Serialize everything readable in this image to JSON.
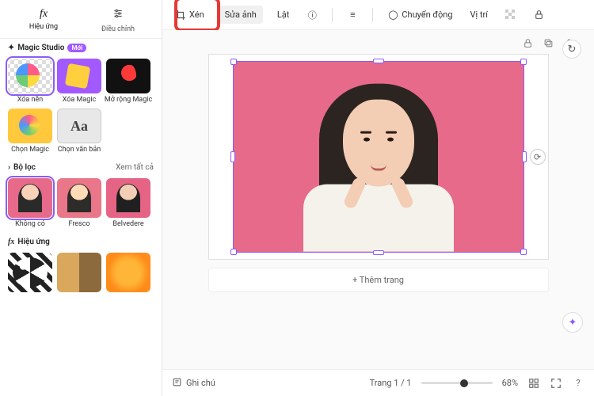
{
  "left_panel": {
    "tabs": [
      {
        "label": "Hiệu ứng",
        "icon": "fx"
      },
      {
        "label": "Điều chỉnh",
        "icon": "adjust"
      }
    ],
    "magic_studio": {
      "title": "Magic Studio",
      "badge": "Mới",
      "tools": [
        {
          "label": "Xóa nền"
        },
        {
          "label": "Xóa Magic"
        },
        {
          "label": "Mở rộng Magic"
        },
        {
          "label": "Chọn Magic"
        },
        {
          "label": "Chọn văn bản"
        }
      ],
      "see_all": "Xem tất cả"
    },
    "filters": {
      "title": "Bộ lọc",
      "items": [
        {
          "label": "Không có"
        },
        {
          "label": "Fresco"
        },
        {
          "label": "Belvedere"
        }
      ]
    },
    "effects": {
      "title": "Hiệu ứng"
    }
  },
  "top_toolbar": {
    "crop": "Xén",
    "edit_image": "Sửa ảnh",
    "flip": "Lật",
    "animation": "Chuyển động",
    "position": "Vị trí"
  },
  "canvas": {
    "add_page": "+ Thêm trang"
  },
  "bottom_bar": {
    "notes": "Ghi chú",
    "page_indicator": "Trang 1 / 1",
    "zoom": "68%"
  }
}
